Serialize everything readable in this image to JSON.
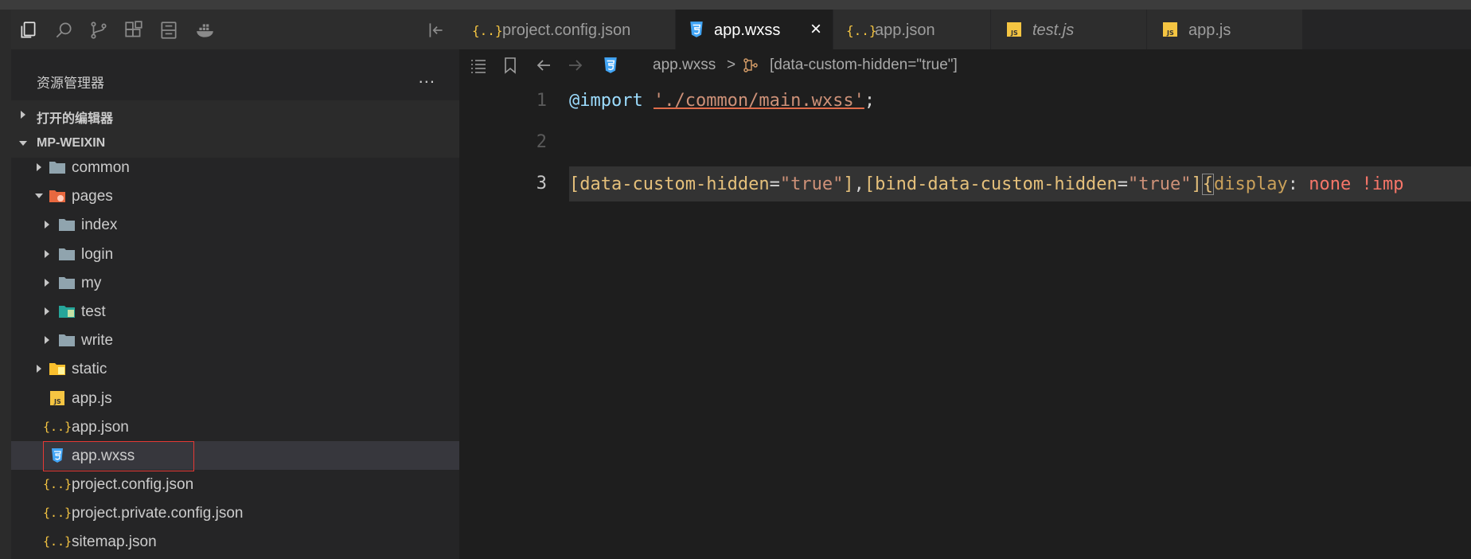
{
  "explorer": {
    "title": "资源管理器",
    "more": "...",
    "open_editors_label": "打开的编辑器",
    "project_label": "MP-WEIXIN",
    "tree": [
      {
        "name": "common",
        "type": "folder",
        "expanded": false
      },
      {
        "name": "pages",
        "type": "folder-special",
        "expanded": true
      },
      {
        "name": "index",
        "type": "folder",
        "expanded": false
      },
      {
        "name": "login",
        "type": "folder",
        "expanded": false
      },
      {
        "name": "my",
        "type": "folder",
        "expanded": false
      },
      {
        "name": "test",
        "type": "folder-test",
        "expanded": false
      },
      {
        "name": "write",
        "type": "folder",
        "expanded": false
      },
      {
        "name": "static",
        "type": "folder-static",
        "expanded": false
      },
      {
        "name": "app.js",
        "type": "js"
      },
      {
        "name": "app.json",
        "type": "json"
      },
      {
        "name": "app.wxss",
        "type": "css",
        "selected": true
      },
      {
        "name": "project.config.json",
        "type": "json"
      },
      {
        "name": "project.private.config.json",
        "type": "json"
      },
      {
        "name": "sitemap.json",
        "type": "json"
      }
    ]
  },
  "tabs": [
    {
      "label": "project.config.json",
      "type": "json",
      "active": false
    },
    {
      "label": "app.wxss",
      "type": "css",
      "active": true,
      "close": "×"
    },
    {
      "label": "app.json",
      "type": "json",
      "active": false
    },
    {
      "label": "test.js",
      "type": "js",
      "active": false,
      "italic": true
    },
    {
      "label": "app.js",
      "type": "js",
      "active": false
    }
  ],
  "breadcrumb": {
    "file": "app.wxss",
    "separator": ">",
    "symbol": "[data-custom-hidden=\"true\"]"
  },
  "code": {
    "line_numbers": [
      "1",
      "2",
      "3"
    ],
    "line1": {
      "kw": "@import",
      "space": " ",
      "str": "'./common/main.wxss'",
      "end": ";"
    },
    "line3": {
      "b1": "[",
      "attr1": "data-custom-hidden",
      "eq1": "=",
      "v1": "\"true\"",
      "b2": "]",
      "comma": ",",
      "b3": "[",
      "attr2": "bind-data-custom-hidden",
      "eq2": "=",
      "v2": "\"true\"",
      "b4": "]",
      "brace": "{",
      "prop": "display",
      "colon": ": ",
      "val": "none !imp"
    }
  },
  "colors": {
    "accent_selection": "#e53935",
    "folder": "#90a4ae",
    "json_icon": "#f5c542",
    "js_icon": "#f5c542",
    "css_icon": "#42a5f5"
  }
}
